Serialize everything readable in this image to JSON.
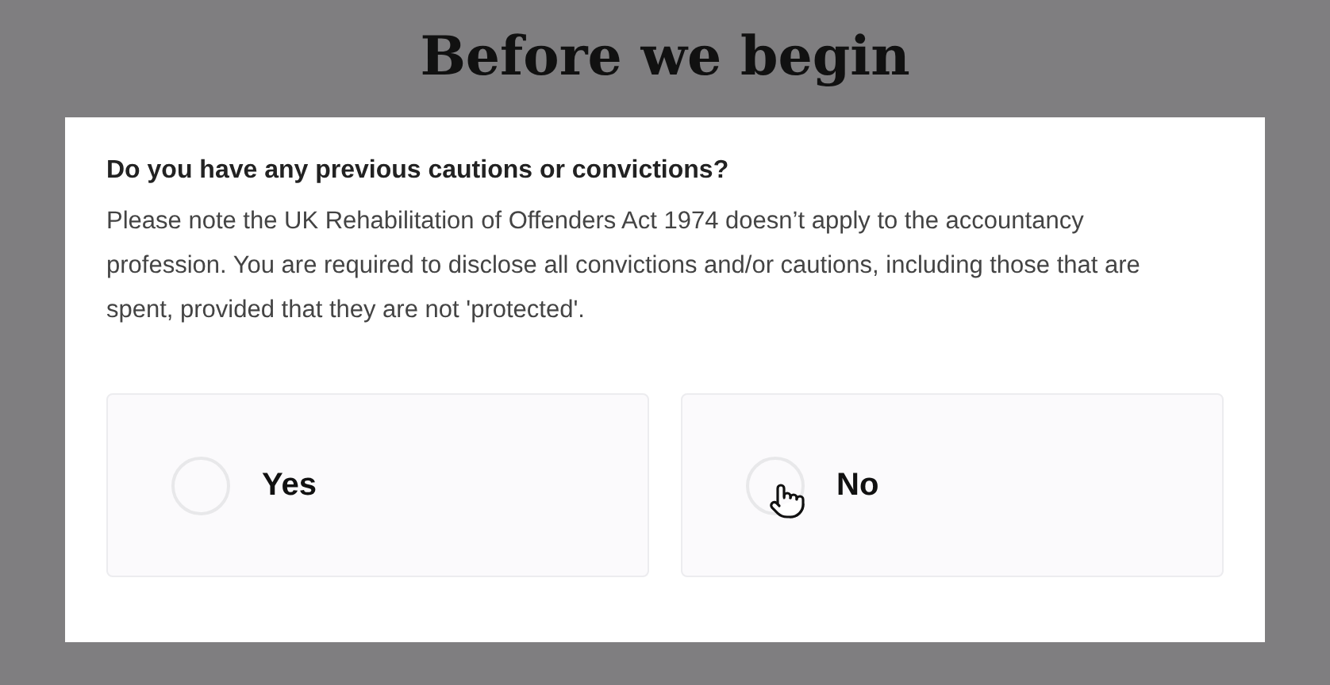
{
  "title": "Before we begin",
  "question": {
    "label": "Do you have any previous cautions or convictions?",
    "note": "Please note the UK Rehabilitation of Offenders Act 1974 doesn’t apply to the accountancy profession. You are required to disclose all convictions and/or cautions, including those that are spent, provided that they are not 'protected'."
  },
  "options": [
    {
      "label": "Yes",
      "selected": false
    },
    {
      "label": "No",
      "selected": false
    }
  ]
}
